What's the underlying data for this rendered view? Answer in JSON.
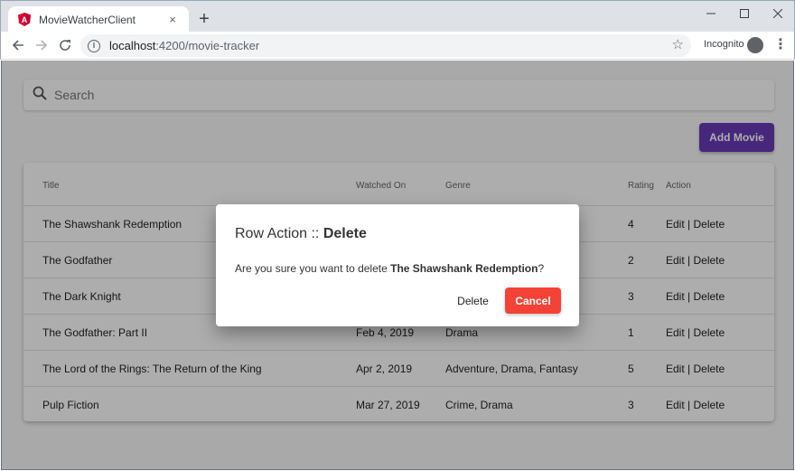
{
  "browser": {
    "tab_title": "MovieWatcherClient",
    "tab_close": "×",
    "new_tab": "+",
    "url_host": "localhost",
    "url_path": ":4200/movie-tracker",
    "incognito_label": "Incognito",
    "window_controls": [
      "minimize-icon",
      "maximize-icon",
      "close-icon"
    ]
  },
  "search": {
    "placeholder": "Search",
    "value": ""
  },
  "add_button_label": "Add Movie",
  "table": {
    "headers": {
      "title": "Title",
      "watched_on": "Watched On",
      "genre": "Genre",
      "rating": "Rating",
      "action": "Action"
    },
    "rows": [
      {
        "title": "The Shawshank Redemption",
        "watched_on": "",
        "genre": "",
        "rating": "4",
        "edit": "Edit",
        "sep": " | ",
        "delete": "Delete"
      },
      {
        "title": "The Godfather",
        "watched_on": "",
        "genre": "",
        "rating": "2",
        "edit": "Edit",
        "sep": " | ",
        "delete": "Delete"
      },
      {
        "title": "The Dark Knight",
        "watched_on": "",
        "genre": "",
        "rating": "3",
        "edit": "Edit",
        "sep": " | ",
        "delete": "Delete"
      },
      {
        "title": "The Godfather: Part II",
        "watched_on": "Feb 4, 2019",
        "genre": "Drama",
        "rating": "1",
        "edit": "Edit",
        "sep": " | ",
        "delete": "Delete"
      },
      {
        "title": "The Lord of the Rings: The Return of the King",
        "watched_on": "Apr 2, 2019",
        "genre": "Adventure, Drama, Fantasy",
        "rating": "5",
        "edit": "Edit",
        "sep": " | ",
        "delete": "Delete"
      },
      {
        "title": "Pulp Fiction",
        "watched_on": "Mar 27, 2019",
        "genre": "Crime, Drama",
        "rating": "3",
        "edit": "Edit",
        "sep": " | ",
        "delete": "Delete"
      }
    ]
  },
  "dialog": {
    "title_prefix": "Row Action :: ",
    "title_action": "Delete",
    "message_prefix": "Are you sure you want to delete ",
    "message_movie": "The Shawshank Redemption",
    "message_suffix": "?",
    "delete_label": "Delete",
    "cancel_label": "Cancel"
  },
  "colors": {
    "primary": "#673ab7",
    "warn": "#f44336",
    "angular_logo": "#dd0031"
  }
}
